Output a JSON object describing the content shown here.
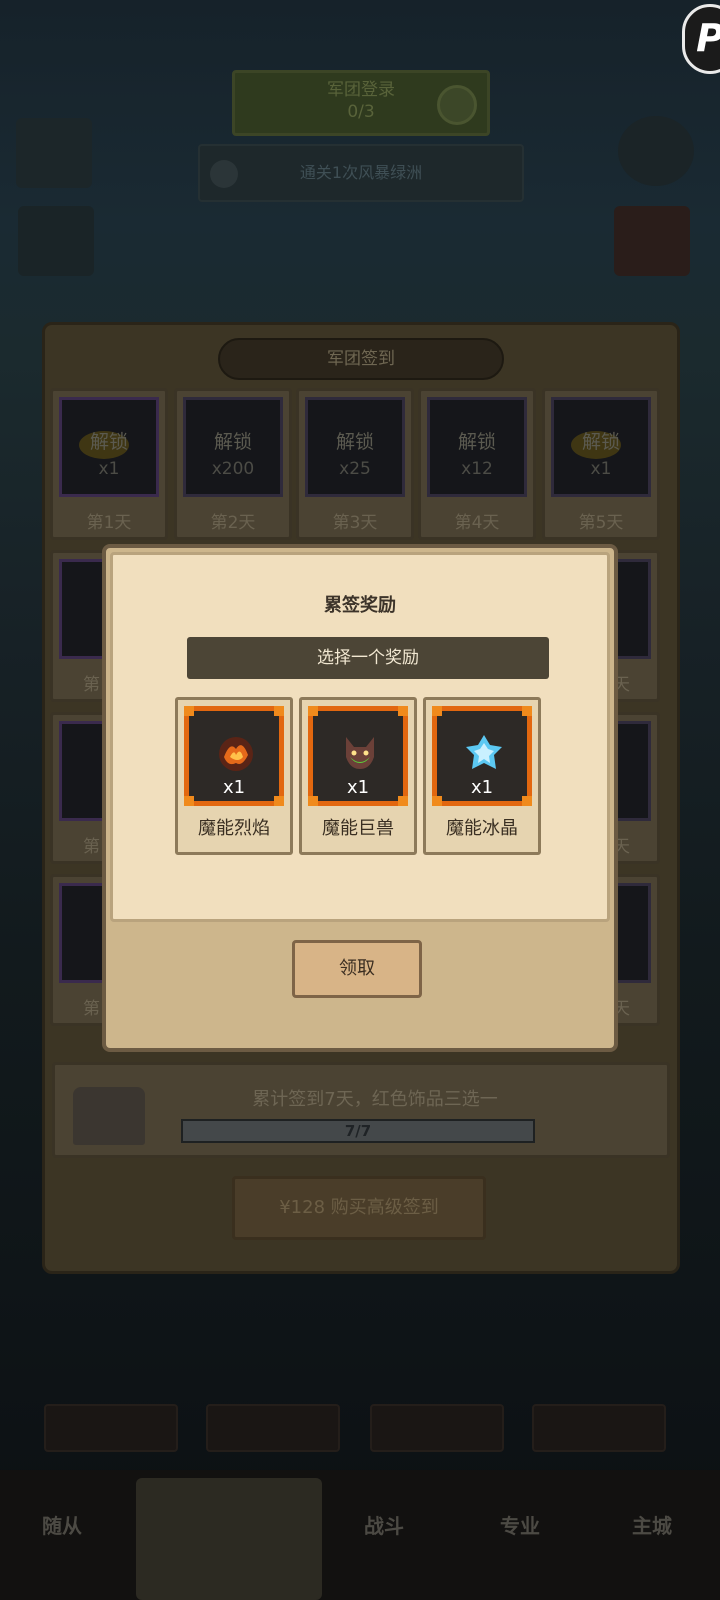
{
  "background": {
    "quest_button": {
      "line1": "军团登录",
      "line2": "0/3"
    },
    "task_bar": "通关1次风暴绿洲",
    "side_labels": {
      "left1": "",
      "left2": "",
      "right1": "",
      "right2": ""
    }
  },
  "panel": {
    "title": "军团签到",
    "days": [
      {
        "lock": "解锁",
        "qty": "x1",
        "label": "第1天"
      },
      {
        "lock": "解锁",
        "qty": "x200",
        "label": "第2天"
      },
      {
        "lock": "解锁",
        "qty": "x25",
        "label": "第3天"
      },
      {
        "lock": "解锁",
        "qty": "x12",
        "label": "第4天"
      },
      {
        "lock": "解锁",
        "qty": "x1",
        "label": "第5天"
      }
    ],
    "partial_rows": [
      {
        "left": "第",
        "right": "天"
      },
      {
        "left": "第",
        "right": "天"
      },
      {
        "left": "第",
        "right": "天"
      }
    ],
    "total": {
      "text": "累计签到7天，红色饰品三选一",
      "progress_text": "7/7",
      "progress_fraction": 1.0
    },
    "buy_button": "¥128 购买高级签到"
  },
  "nav": {
    "small_tabs": [
      "",
      "",
      "",
      ""
    ],
    "items": {
      "left": "随从",
      "equip": "",
      "battle": "战斗",
      "pro": "专业",
      "city": "主城"
    }
  },
  "dialog": {
    "title": "累签奖励",
    "subtitle": "选择一个奖励",
    "rewards": [
      {
        "name": "魔能烈焰",
        "qty": "x1",
        "icon": "flame-orb-icon"
      },
      {
        "name": "魔能巨兽",
        "qty": "x1",
        "icon": "beast-head-icon"
      },
      {
        "name": "魔能冰晶",
        "qty": "x1",
        "icon": "ice-crystal-icon"
      }
    ],
    "claim_button": "领取"
  },
  "colors": {
    "frame_orange": "#e2670f",
    "dialog_paper": "#f1dfbe",
    "subtitle_bar": "#4c4536"
  },
  "corner_logo": "P"
}
